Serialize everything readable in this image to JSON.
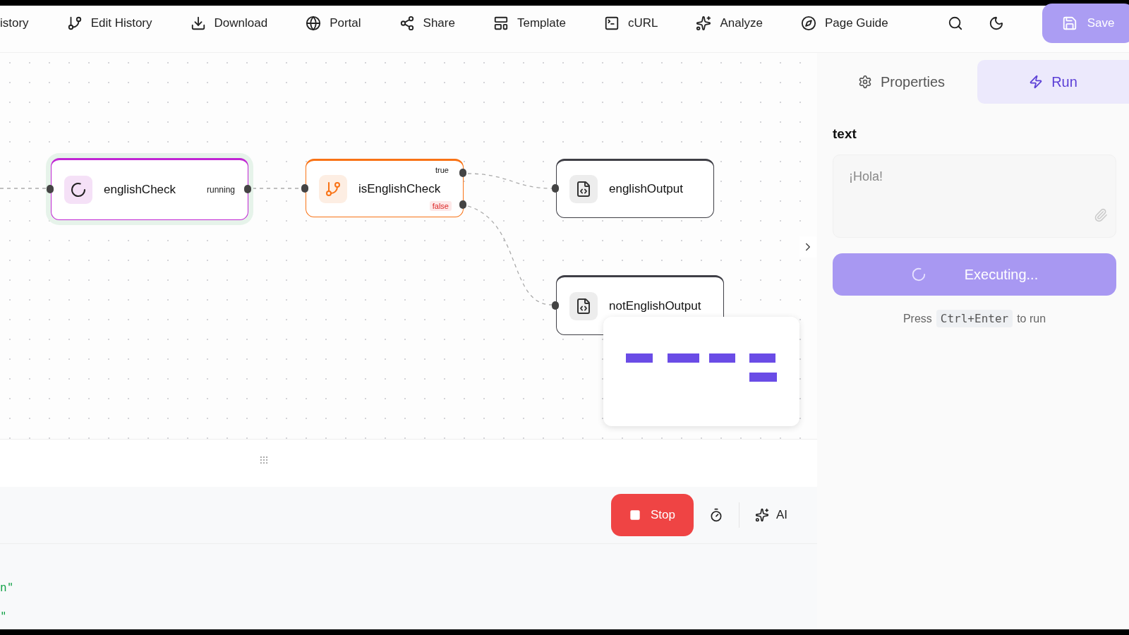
{
  "toolbar": {
    "items": [
      {
        "label": "istory"
      },
      {
        "label": "Edit History"
      },
      {
        "label": "Download"
      },
      {
        "label": "Portal"
      },
      {
        "label": "Share"
      },
      {
        "label": "Template"
      },
      {
        "label": "cURL"
      },
      {
        "label": "Analyze"
      },
      {
        "label": "Page Guide"
      }
    ],
    "save": {
      "label": "Save",
      "disabled": true
    }
  },
  "canvas": {
    "nodes": [
      {
        "kind": "loop",
        "title": "englishCheck",
        "status": "running",
        "color": "#c026d3"
      },
      {
        "kind": "condition",
        "title": "isEnglishCheck",
        "true_label": "true",
        "false_label": "false",
        "color": "#f97316"
      },
      {
        "kind": "output",
        "title": "englishOutput",
        "color": "#3f3f46"
      },
      {
        "kind": "output",
        "title": "notEnglishOutput",
        "color": "#3f3f46"
      }
    ]
  },
  "bottom_bar": {
    "stop": "Stop",
    "ai": "AI"
  },
  "code_lines": [
    "n\"",
    "\""
  ],
  "panel": {
    "tabs": [
      {
        "label": "Properties",
        "selected": false
      },
      {
        "label": "Run",
        "selected": true
      }
    ],
    "field": {
      "label": "text",
      "value": "¡Hola!"
    },
    "run_button": {
      "label": "Executing...",
      "busy": true
    },
    "hint": {
      "before": "Press",
      "key": "Ctrl+Enter",
      "after": "to run"
    }
  }
}
